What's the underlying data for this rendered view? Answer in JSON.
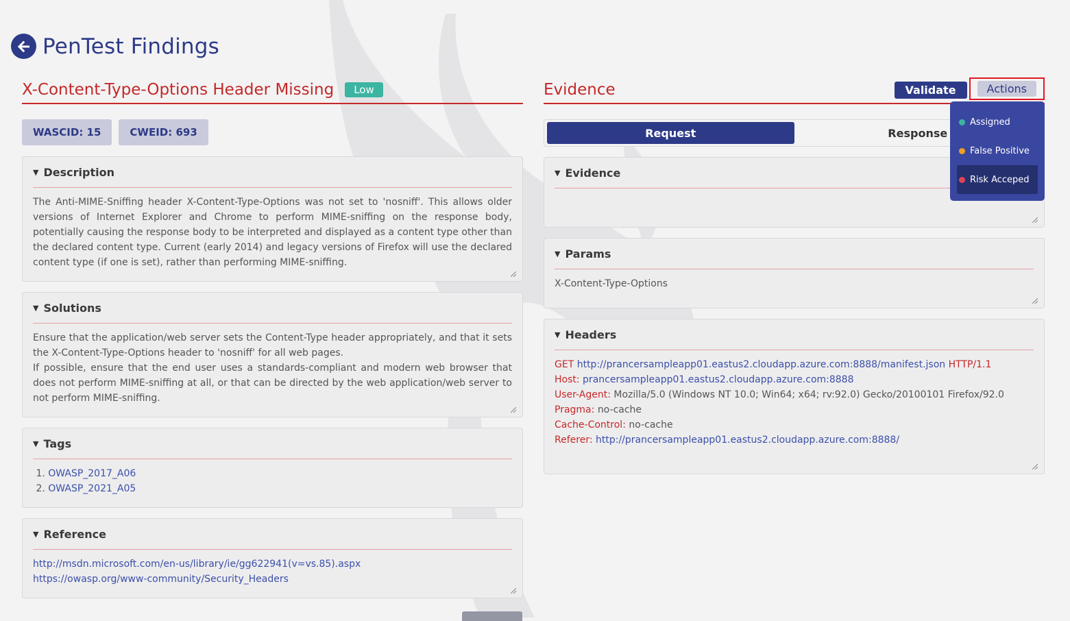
{
  "header": {
    "title": "PenTest Findings"
  },
  "finding": {
    "title": "X-Content-Type-Options Header Missing",
    "severity": "Low",
    "wascid": "WASCID: 15",
    "cweid": "CWEID: 693"
  },
  "description": {
    "label": "Description",
    "text": "The Anti-MIME-Sniffing header X-Content-Type-Options was not set to 'nosniff'. This allows older versions of Internet Explorer and Chrome to perform MIME-sniffing on the response body, potentially causing the response body to be interpreted and displayed as a content type other than the declared content type. Current (early 2014) and legacy versions of Firefox will use the declared content type (if one is set), rather than performing MIME-sniffing."
  },
  "solutions": {
    "label": "Solutions",
    "line1": "Ensure that the application/web server sets the Content-Type header appropriately, and that it sets the X-Content-Type-Options header to 'nosniff' for all web pages.",
    "line2": "If possible, ensure that the end user uses a standards-compliant and modern web browser that does not perform MIME-sniffing at all, or that can be directed by the web application/web server to not perform MIME-sniffing."
  },
  "tags": {
    "label": "Tags",
    "items": [
      "OWASP_2017_A06",
      "OWASP_2021_A05"
    ]
  },
  "reference": {
    "label": "Reference",
    "links": [
      "http://msdn.microsoft.com/en-us/library/ie/gg622941(v=vs.85).aspx",
      "https://owasp.org/www-community/Security_Headers"
    ]
  },
  "evidence_panel": {
    "title": "Evidence",
    "validate_label": "Validate",
    "actions_label": "Actions",
    "tabs": {
      "request": "Request",
      "response": "Response"
    },
    "evidence": {
      "label": "Evidence",
      "text": ""
    },
    "params": {
      "label": "Params",
      "text": "X-Content-Type-Options"
    },
    "headers": {
      "label": "Headers",
      "request_line": {
        "method": "GET",
        "url": "http://prancersampleapp01.eastus2.cloudapp.azure.com:8888/manifest.json",
        "version": "HTTP/1.1"
      },
      "host": {
        "key": "Host:",
        "value": "prancersampleapp01.eastus2.cloudapp.azure.com:8888"
      },
      "user_agent": {
        "key": "User-Agent:",
        "value": "Mozilla/5.0 (Windows NT 10.0; Win64; x64; rv:92.0) Gecko/20100101 Firefox/92.0"
      },
      "pragma": {
        "key": "Pragma:",
        "value": "no-cache"
      },
      "cache_control": {
        "key": "Cache-Control:",
        "value": "no-cache"
      },
      "referer": {
        "key": "Referer:",
        "value": "http://prancersampleapp01.eastus2.cloudapp.azure.com:8888/"
      }
    }
  },
  "actions_menu": {
    "items": [
      {
        "label": "Assigned",
        "color": "#3bb5a1"
      },
      {
        "label": "False Positive",
        "color": "#f0a020"
      },
      {
        "label": "Risk Acceped",
        "color": "#e0445a"
      }
    ]
  },
  "colors": {
    "brand": "#2d3a87",
    "accent_red": "#c62828",
    "low_badge": "#3bb5a1"
  }
}
